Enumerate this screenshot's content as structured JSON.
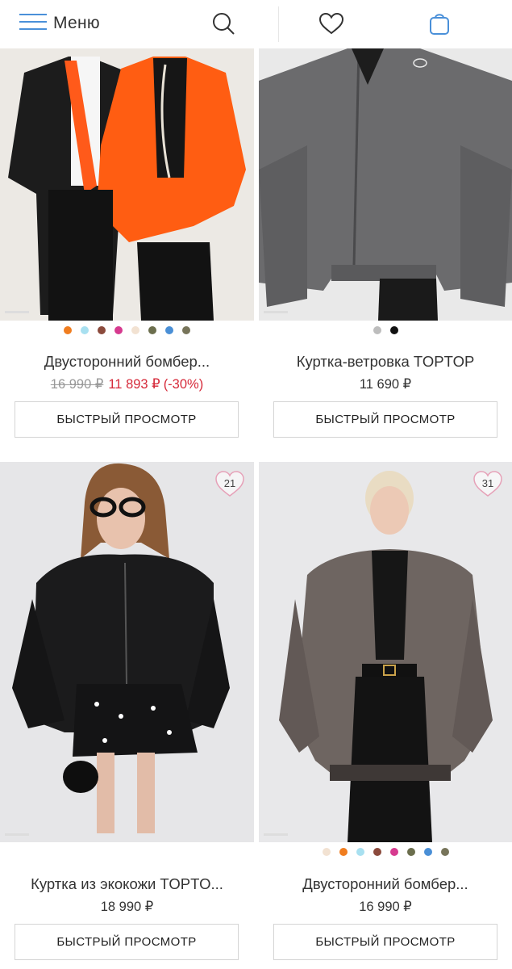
{
  "header": {
    "menu_label": "Меню",
    "icons": [
      "hamburger-icon",
      "search-icon",
      "heart-icon",
      "bag-icon"
    ],
    "accent": "#4a90d9"
  },
  "products": [
    {
      "title": "Двусторонний бомбер...",
      "old_price": "16 990 ₽",
      "price": "11 893 ₽",
      "discount": "(-30%)",
      "favorites": "",
      "swatches": [
        "#f07d1f",
        "#a8e0f0",
        "#8b4a3c",
        "#d63a8f",
        "#f2e2d2",
        "#6b6e4d",
        "#4a8fd6",
        "#77745a"
      ],
      "button": "БЫСТРЫЙ ПРОСМОТР"
    },
    {
      "title": "Куртка-ветровка TOPTOP",
      "old_price": "",
      "price": "11 690 ₽",
      "discount": "",
      "favorites": "",
      "swatches": [
        "#bdbdbd",
        "#111111"
      ],
      "button": "БЫСТРЫЙ ПРОСМОТР"
    },
    {
      "title": "Куртка из экокожи TOPTO...",
      "old_price": "",
      "price": "18 990 ₽",
      "discount": "",
      "favorites": "21",
      "swatches": [],
      "button": "БЫСТРЫЙ ПРОСМОТР"
    },
    {
      "title": "Двусторонний бомбер...",
      "old_price": "",
      "price": "16 990 ₽",
      "discount": "",
      "favorites": "31",
      "swatches": [
        "#f2e2d2",
        "#f07d1f",
        "#a8e0f0",
        "#8b4a3c",
        "#d63a8f",
        "#6b6e4d",
        "#4a8fd6",
        "#77745a"
      ],
      "button": "БЫСТРЫЙ ПРОСМОТР"
    }
  ]
}
